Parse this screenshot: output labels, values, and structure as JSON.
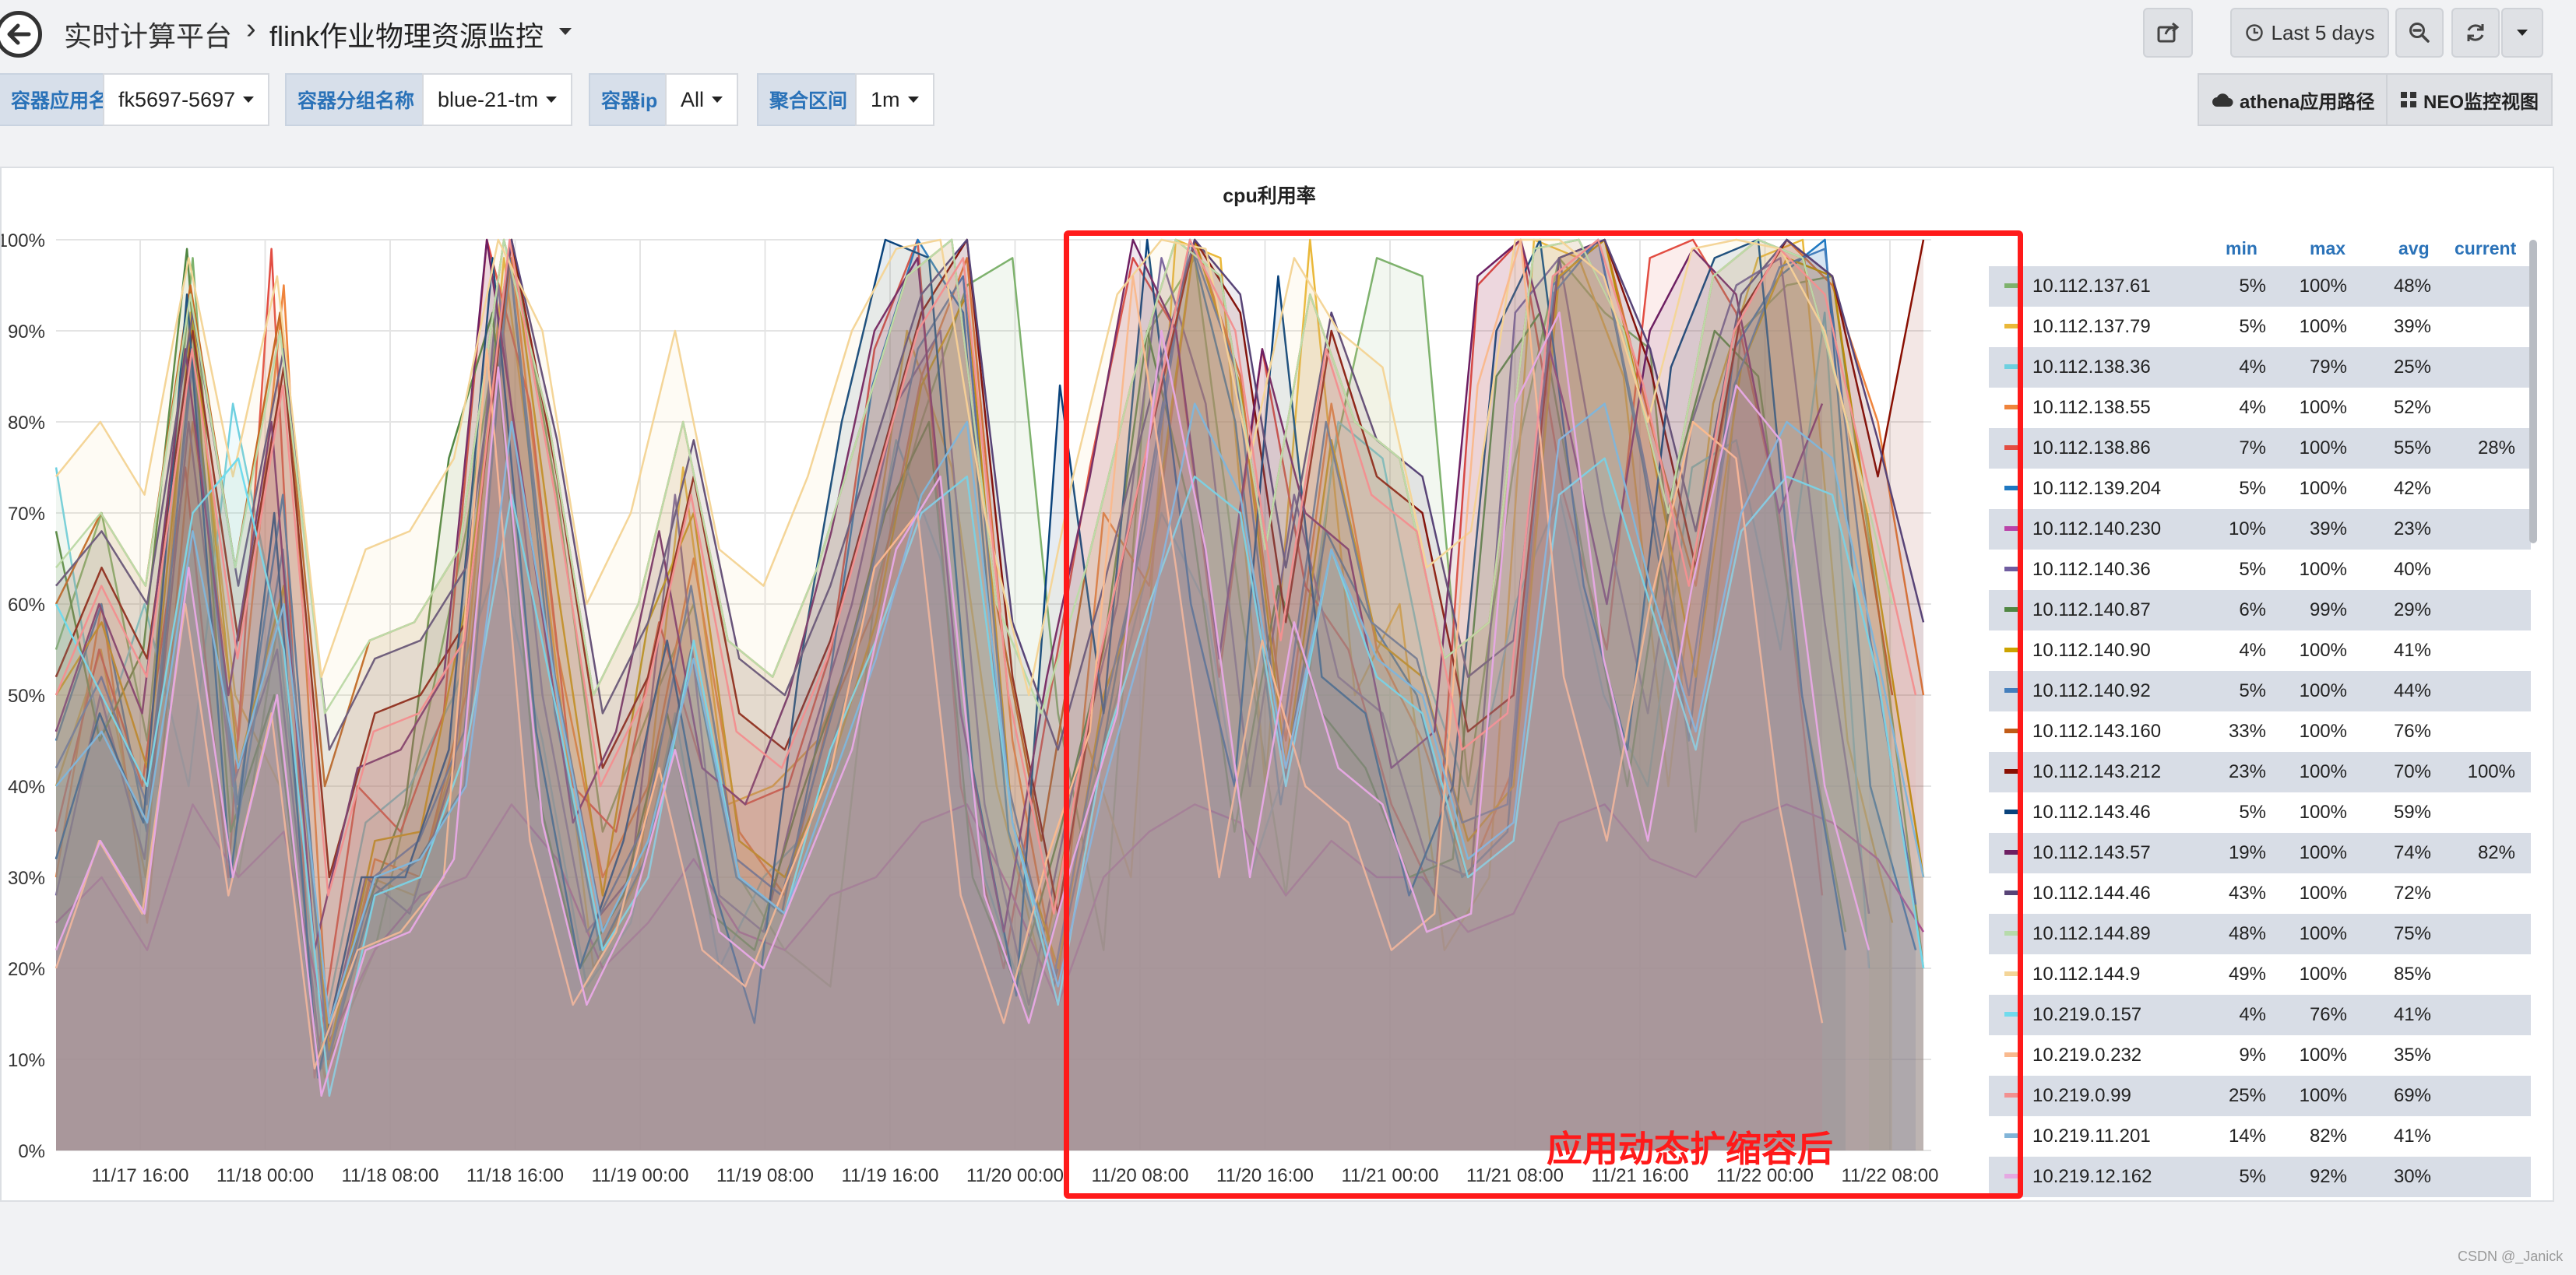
{
  "navbar": {
    "breadcrumb_root": "实时计算平台",
    "breadcrumb_sep": "›",
    "dashboard_title": "flink作业物理资源监控",
    "time_range": "Last 5 days"
  },
  "variables": [
    {
      "label": "容器应用名",
      "value": "fk5697-5697"
    },
    {
      "label": "容器分组名称",
      "value": "blue-21-tm"
    },
    {
      "label": "容器ip",
      "value": "All"
    },
    {
      "label": "聚合区间",
      "value": "1m"
    }
  ],
  "links": {
    "athena": "athena应用路径",
    "neo": "NEO监控视图"
  },
  "panel": {
    "title": "cpu利用率"
  },
  "colors": {
    "annotation": "#ff1a1a",
    "var_label_text": "#2a72b8",
    "legend_header": "#2a72b8"
  },
  "chart_data": {
    "type": "line",
    "title": "cpu利用率",
    "ylim": [
      0,
      100
    ],
    "y_unit": "%",
    "y_ticks": [
      "0%",
      "10%",
      "20%",
      "30%",
      "40%",
      "50%",
      "60%",
      "70%",
      "80%",
      "90%",
      "100%"
    ],
    "x_ticks": [
      "11/17 16:00",
      "11/18 00:00",
      "11/18 08:00",
      "11/18 16:00",
      "11/19 00:00",
      "11/19 08:00",
      "11/19 16:00",
      "11/20 00:00",
      "11/20 08:00",
      "11/20 16:00",
      "11/21 00:00",
      "11/21 08:00",
      "11/21 16:00",
      "11/22 00:00",
      "11/22 08:00"
    ],
    "grid": true,
    "legend_position": "right",
    "legend_columns": [
      "min",
      "max",
      "avg",
      "current"
    ],
    "annotation": "应用动态扩缩容后",
    "series": [
      {
        "name": "10.112.137.61",
        "color": "#7eb26d",
        "min": "5%",
        "max": "100%",
        "avg": "48%",
        "current": "",
        "y": [
          55,
          70,
          45,
          98,
          30,
          62,
          10,
          22,
          44,
          68,
          100,
          72,
          35,
          48,
          60,
          30,
          22,
          18,
          62,
          80,
          95,
          98,
          48,
          22,
          90,
          98,
          60,
          28,
          75,
          98,
          96,
          40,
          75,
          98,
          92,
          88,
          35,
          90,
          95,
          96,
          60,
          20
        ]
      },
      {
        "name": "10.112.137.79",
        "color": "#eab839",
        "min": "5%",
        "max": "100%",
        "avg": "39%",
        "current": "",
        "y": [
          40,
          55,
          30,
          92,
          50,
          40,
          8,
          30,
          28,
          45,
          98,
          60,
          20,
          30,
          75,
          38,
          40,
          45,
          58,
          90,
          75,
          40,
          20,
          45,
          30,
          100,
          98,
          40,
          100,
          50,
          60,
          22,
          30,
          100,
          98,
          85,
          40,
          82,
          98,
          100,
          45,
          25
        ]
      },
      {
        "name": "10.112.138.36",
        "color": "#6ed0e0",
        "min": "4%",
        "max": "79%",
        "avg": "25%",
        "current": "",
        "y": [
          75,
          45,
          60,
          40,
          82,
          58,
          12,
          36,
          40,
          50,
          65,
          45,
          18,
          25,
          48,
          20,
          30,
          35,
          52,
          78,
          65,
          30,
          15,
          32,
          50,
          70,
          60,
          30,
          45,
          80,
          76,
          52,
          38,
          60,
          72,
          50,
          40,
          75,
          78,
          55,
          92,
          20
        ]
      },
      {
        "name": "10.112.138.55",
        "color": "#ef843c",
        "min": "4%",
        "max": "100%",
        "avg": "52%",
        "current": "",
        "y": [
          30,
          60,
          25,
          80,
          45,
          95,
          10,
          32,
          30,
          50,
          98,
          55,
          30,
          40,
          65,
          35,
          28,
          48,
          60,
          85,
          98,
          45,
          18,
          70,
          62,
          100,
          85,
          45,
          82,
          55,
          45,
          30,
          42,
          98,
          100,
          80,
          62,
          92,
          100,
          95,
          80,
          50
        ]
      },
      {
        "name": "10.112.138.86",
        "color": "#e24d42",
        "min": "7%",
        "max": "100%",
        "avg": "55%",
        "current": "28%",
        "y": [
          35,
          55,
          40,
          75,
          30,
          99,
          8,
          40,
          35,
          48,
          100,
          82,
          40,
          35,
          58,
          42,
          38,
          40,
          55,
          88,
          100,
          40,
          20,
          48,
          75,
          98,
          90,
          52,
          88,
          62,
          55,
          38,
          28,
          95,
          100,
          72,
          55,
          98,
          100,
          92,
          70,
          28
        ]
      },
      {
        "name": "10.112.139.204",
        "color": "#1f78c1",
        "min": "5%",
        "max": "100%",
        "avg": "42%",
        "current": "",
        "y": [
          45,
          60,
          35,
          88,
          38,
          72,
          10,
          28,
          32,
          40,
          98,
          48,
          22,
          32,
          55,
          30,
          26,
          50,
          84,
          100,
          92,
          35,
          18,
          42,
          70,
          100,
          80,
          38,
          68,
          58,
          50,
          30,
          35,
          95,
          100,
          75,
          45,
          88,
          96,
          100,
          40,
          22
        ]
      },
      {
        "name": "10.112.140.230",
        "color": "#ba43a9",
        "min": "10%",
        "max": "39%",
        "avg": "23%",
        "current": "",
        "y": [
          25,
          30,
          22,
          38,
          30,
          35,
          12,
          22,
          28,
          30,
          38,
          32,
          20,
          25,
          32,
          24,
          22,
          28,
          30,
          36,
          38,
          28,
          16,
          30,
          35,
          38,
          36,
          28,
          34,
          30,
          30,
          24,
          26,
          36,
          38,
          32,
          30,
          36,
          38,
          36,
          32,
          24
        ]
      },
      {
        "name": "10.112.140.36",
        "color": "#705da0",
        "min": "5%",
        "max": "100%",
        "avg": "40%",
        "current": "",
        "y": [
          28,
          50,
          32,
          80,
          40,
          55,
          9,
          30,
          26,
          42,
          95,
          50,
          24,
          30,
          72,
          28,
          24,
          44,
          60,
          82,
          90,
          38,
          16,
          40,
          60,
          98,
          82,
          40,
          72,
          52,
          48,
          32,
          30,
          92,
          98,
          70,
          48,
          80,
          95,
          98,
          58,
          26
        ]
      },
      {
        "name": "10.112.140.87",
        "color": "#508642",
        "min": "6%",
        "max": "99%",
        "avg": "29%",
        "current": "",
        "y": [
          68,
          45,
          55,
          99,
          35,
          50,
          10,
          25,
          38,
          76,
          92,
          40,
          20,
          28,
          48,
          26,
          22,
          38,
          52,
          70,
          80,
          30,
          18,
          35,
          55,
          90,
          70,
          35,
          62,
          48,
          42,
          30,
          32,
          85,
          92,
          65,
          40,
          72,
          90,
          85,
          50,
          24
        ]
      },
      {
        "name": "10.112.140.90",
        "color": "#cca300",
        "min": "4%",
        "max": "100%",
        "avg": "41%",
        "current": "",
        "y": [
          50,
          58,
          42,
          92,
          42,
          62,
          11,
          34,
          35,
          60,
          100,
          62,
          28,
          58,
          70,
          34,
          30,
          42,
          58,
          84,
          94,
          36,
          20,
          50,
          64,
          100,
          84,
          42,
          78,
          56,
          52,
          34,
          40,
          96,
          100,
          78,
          52,
          86,
          98,
          96,
          62,
          30
        ]
      },
      {
        "name": "10.112.140.92",
        "color": "#447ebc",
        "min": "5%",
        "max": "100%",
        "avg": "44%",
        "current": "",
        "y": [
          42,
          52,
          38,
          86,
          36,
          66,
          10,
          30,
          34,
          46,
          98,
          52,
          26,
          36,
          62,
          32,
          28,
          46,
          64,
          88,
          96,
          40,
          19,
          46,
          68,
          100,
          86,
          44,
          80,
          58,
          54,
          36,
          38,
          94,
          100,
          76,
          50,
          84,
          97,
          99,
          56,
          27
        ]
      },
      {
        "name": "10.112.143.160",
        "color": "#c15c17",
        "min": "33%",
        "max": "100%",
        "avg": "76%",
        "current": "",
        "y": [
          60,
          70,
          62,
          95,
          64,
          92,
          40,
          56,
          58,
          66,
          100,
          80,
          50,
          60,
          80,
          56,
          52,
          64,
          80,
          96,
          100,
          60,
          34,
          64,
          84,
          100,
          96,
          66,
          94,
          80,
          76,
          54,
          58,
          99,
          100,
          90,
          70,
          96,
          100,
          98,
          80,
          50
        ]
      },
      {
        "name": "10.112.143.212",
        "color": "#890f02",
        "min": "23%",
        "max": "100%",
        "avg": "70%",
        "current": "100%",
        "y": [
          52,
          64,
          54,
          90,
          56,
          86,
          30,
          48,
          50,
          58,
          100,
          74,
          42,
          52,
          74,
          48,
          44,
          56,
          74,
          92,
          100,
          52,
          26,
          56,
          78,
          100,
          92,
          58,
          90,
          74,
          70,
          46,
          50,
          98,
          100,
          86,
          64,
          92,
          100,
          96,
          74,
          100
        ]
      },
      {
        "name": "10.112.143.46",
        "color": "#0a437c",
        "min": "5%",
        "max": "100%",
        "avg": "59%",
        "current": "",
        "y": [
          32,
          48,
          36,
          94,
          30,
          70,
          8,
          30,
          30,
          44,
          98,
          46,
          20,
          34,
          56,
          30,
          14,
          52,
          80,
          100,
          98,
          42,
          17,
          84,
          48,
          100,
          60,
          40,
          96,
          52,
          48,
          28,
          40,
          90,
          100,
          62,
          44,
          86,
          98,
          100,
          50,
          22
        ]
      },
      {
        "name": "10.112.143.57",
        "color": "#6d1f62",
        "min": "19%",
        "max": "100%",
        "avg": "74%",
        "current": "82%",
        "y": [
          46,
          60,
          48,
          88,
          50,
          80,
          22,
          42,
          44,
          52,
          100,
          68,
          36,
          46,
          68,
          42,
          38,
          50,
          68,
          90,
          98,
          48,
          24,
          52,
          74,
          100,
          90,
          54,
          88,
          70,
          66,
          42,
          46,
          96,
          100,
          82,
          60,
          90,
          99,
          94,
          70,
          82
        ]
      },
      {
        "name": "10.112.144.46",
        "color": "#584477",
        "min": "43%",
        "max": "100%",
        "avg": "72%",
        "current": "",
        "y": [
          62,
          68,
          60,
          92,
          62,
          88,
          44,
          54,
          56,
          64,
          100,
          78,
          48,
          58,
          78,
          54,
          50,
          62,
          78,
          94,
          100,
          58,
          44,
          62,
          82,
          100,
          94,
          64,
          92,
          78,
          74,
          52,
          56,
          98,
          100,
          88,
          68,
          94,
          100,
          96,
          78,
          58
        ]
      },
      {
        "name": "10.112.144.89",
        "color": "#b7dbab",
        "min": "48%",
        "max": "100%",
        "avg": "75%",
        "current": "",
        "y": [
          64,
          70,
          62,
          94,
          64,
          90,
          48,
          56,
          58,
          66,
          100,
          80,
          50,
          60,
          80,
          56,
          52,
          64,
          80,
          96,
          100,
          60,
          48,
          64,
          84,
          100,
          96,
          66,
          94,
          80,
          76,
          54,
          58,
          99,
          100,
          90,
          70,
          96,
          100,
          98,
          80,
          60
        ]
      },
      {
        "name": "10.112.144.9",
        "color": "#f4d598",
        "min": "49%",
        "max": "100%",
        "avg": "85%",
        "current": "",
        "y": [
          74,
          80,
          72,
          98,
          74,
          96,
          52,
          66,
          68,
          76,
          100,
          90,
          60,
          70,
          90,
          66,
          62,
          74,
          90,
          99,
          100,
          70,
          50,
          74,
          94,
          100,
          99,
          76,
          98,
          90,
          86,
          64,
          68,
          100,
          100,
          96,
          80,
          99,
          100,
          99,
          90,
          70
        ]
      },
      {
        "name": "10.219.0.157",
        "color": "#70dbed",
        "min": "4%",
        "max": "76%",
        "avg": "41%",
        "current": "",
        "y": [
          60,
          50,
          40,
          70,
          76,
          55,
          6,
          28,
          30,
          44,
          72,
          48,
          22,
          30,
          56,
          30,
          26,
          44,
          56,
          70,
          74,
          36,
          16,
          44,
          60,
          74,
          70,
          40,
          66,
          52,
          48,
          30,
          34,
          72,
          76,
          60,
          44,
          68,
          74,
          72,
          52,
          20
        ]
      },
      {
        "name": "10.219.0.232",
        "color": "#f9ba8f",
        "min": "9%",
        "max": "100%",
        "avg": "35%",
        "current": "",
        "y": [
          20,
          34,
          26,
          60,
          28,
          48,
          9,
          22,
          24,
          30,
          88,
          34,
          16,
          24,
          42,
          22,
          18,
          30,
          42,
          64,
          70,
          28,
          14,
          32,
          46,
          96,
          64,
          30,
          56,
          40,
          36,
          22,
          26,
          84,
          100,
          52,
          34,
          60,
          80,
          76,
          38,
          14
        ]
      },
      {
        "name": "10.219.0.99",
        "color": "#f29191",
        "min": "25%",
        "max": "100%",
        "avg": "69%",
        "current": "",
        "y": [
          50,
          62,
          52,
          88,
          54,
          84,
          28,
          46,
          48,
          56,
          100,
          72,
          40,
          50,
          72,
          46,
          42,
          54,
          72,
          90,
          98,
          50,
          26,
          54,
          76,
          100,
          90,
          56,
          88,
          72,
          68,
          44,
          48,
          96,
          100,
          84,
          62,
          90,
          99,
          94,
          72,
          50
        ]
      },
      {
        "name": "10.219.11.201",
        "color": "#82b5d8",
        "min": "14%",
        "max": "82%",
        "avg": "41%",
        "current": "",
        "y": [
          40,
          46,
          36,
          68,
          42,
          60,
          14,
          30,
          32,
          40,
          80,
          50,
          24,
          34,
          54,
          30,
          26,
          40,
          54,
          72,
          80,
          36,
          18,
          40,
          58,
          82,
          72,
          42,
          66,
          54,
          50,
          32,
          36,
          78,
          82,
          62,
          46,
          70,
          80,
          76,
          54,
          30
        ]
      },
      {
        "name": "10.219.12.162",
        "color": "#e5a8e2",
        "min": "5%",
        "max": "92%",
        "avg": "30%",
        "current": "",
        "y": [
          22,
          34,
          26,
          64,
          30,
          50,
          6,
          22,
          24,
          32,
          86,
          36,
          16,
          26,
          44,
          24,
          20,
          32,
          44,
          66,
          74,
          28,
          14,
          32,
          48,
          90,
          66,
          30,
          58,
          42,
          38,
          24,
          26,
          82,
          92,
          54,
          34,
          62,
          84,
          78,
          40,
          22
        ]
      }
    ]
  },
  "watermark": "CSDN @_Janick"
}
